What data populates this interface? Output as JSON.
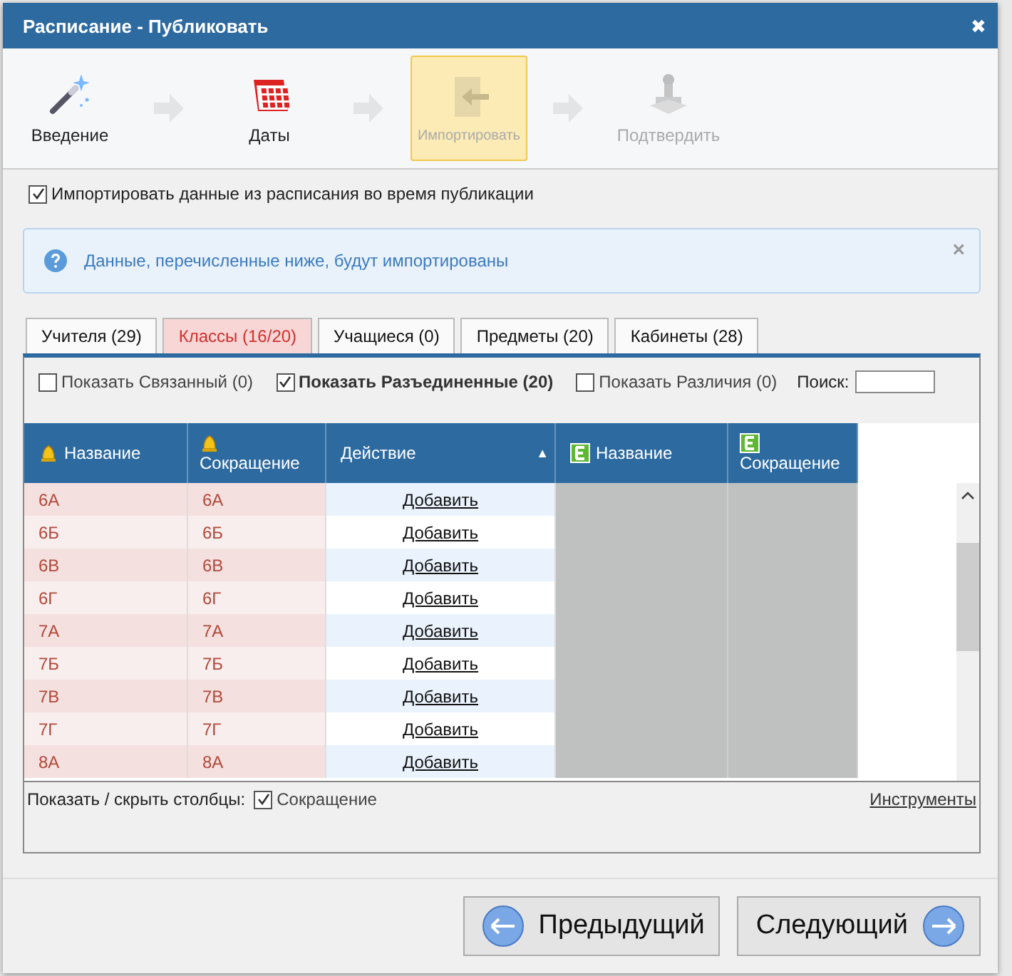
{
  "window": {
    "title": "Расписание - Публиковать",
    "close": "✖"
  },
  "steps": [
    {
      "kind": "wand",
      "label": "Введение",
      "selected": false,
      "disabled": false
    },
    {
      "kind": "calendar",
      "label": "Даты",
      "selected": false,
      "disabled": false
    },
    {
      "kind": "import",
      "label": "Импортировать",
      "selected": true,
      "disabled": true
    },
    {
      "kind": "stamp",
      "label": "Подтвердить",
      "selected": false,
      "disabled": true
    }
  ],
  "import_option": {
    "label": "Импортировать данные из расписания во время публикации",
    "checked": true
  },
  "info": {
    "text": "Данные, перечисленные ниже, будут импортированы",
    "close": "×"
  },
  "tabs": [
    {
      "label": "Учителя (29)",
      "selected": false
    },
    {
      "label": "Классы (16/20)",
      "selected": true
    },
    {
      "label": "Учащиеся (0)",
      "selected": false
    },
    {
      "label": "Предметы (20)",
      "selected": false
    },
    {
      "label": "Кабинеты (28)",
      "selected": false
    }
  ],
  "filters": [
    {
      "label": "Показать Связанный (0)",
      "checked": false
    },
    {
      "label": "Показать Разъединенные (20)",
      "checked": true
    },
    {
      "label": "Показать Различия (0)",
      "checked": false
    }
  ],
  "search": {
    "label": "Поиск:"
  },
  "table": {
    "columns": [
      {
        "label": "Название",
        "kind": "bell"
      },
      {
        "label": "Сокращение",
        "kind": "bell"
      },
      {
        "label": "Действие",
        "kind": "plain",
        "sort_mark": "▲"
      },
      {
        "label": "Название",
        "kind": "e"
      },
      {
        "label": "Сокращение",
        "kind": "e"
      }
    ],
    "rows": [
      {
        "name": "6А",
        "short": "6А",
        "action": "Добавить"
      },
      {
        "name": "6Б",
        "short": "6Б",
        "action": "Добавить"
      },
      {
        "name": "6В",
        "short": "6В",
        "action": "Добавить"
      },
      {
        "name": "6Г",
        "short": "6Г",
        "action": "Добавить"
      },
      {
        "name": "7А",
        "short": "7А",
        "action": "Добавить"
      },
      {
        "name": "7Б",
        "short": "7Б",
        "action": "Добавить"
      },
      {
        "name": "7В",
        "short": "7В",
        "action": "Добавить"
      },
      {
        "name": "7Г",
        "short": "7Г",
        "action": "Добавить"
      },
      {
        "name": "8А",
        "short": "8А",
        "action": "Добавить"
      }
    ]
  },
  "columns_toggle": {
    "label": "Показать / скрыть столбцы:",
    "option": {
      "label": "Сокращение",
      "checked": true
    }
  },
  "tools_link": "Инструменты",
  "buttons": [
    {
      "kind": "back",
      "label": "Предыдущий"
    },
    {
      "kind": "next",
      "label": "Следующий"
    }
  ]
}
